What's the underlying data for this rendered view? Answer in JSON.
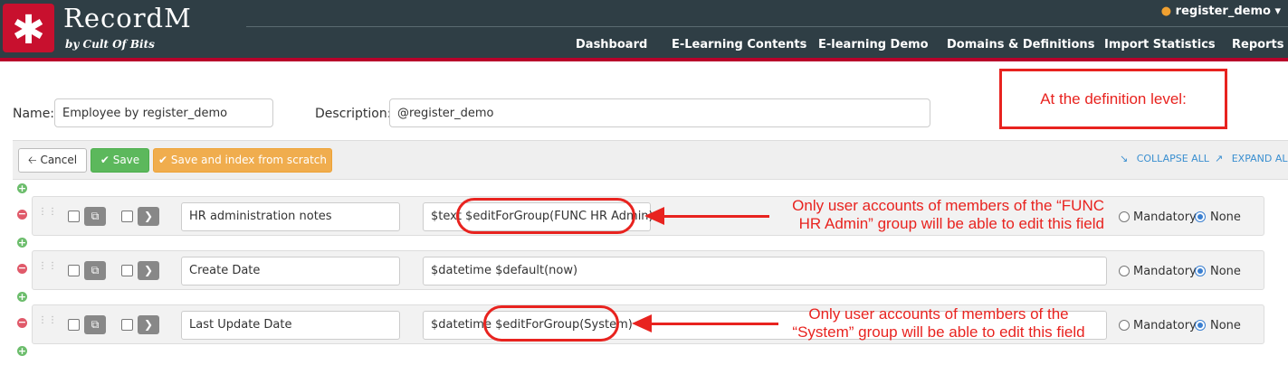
{
  "header": {
    "logo_glyph": "✱",
    "brand": "RecordM",
    "brand_sub": "by Cult Of Bits",
    "user": "register_demo",
    "nav": [
      "Dashboard",
      "E-Learning Contents",
      "E-learning Demo",
      "Domains & Definitions",
      "Import Statistics",
      "Reports"
    ]
  },
  "form": {
    "name_label": "Name:",
    "name_value": "Employee by register_demo",
    "description_label": "Description:",
    "description_value": "@register_demo"
  },
  "toolbar": {
    "cancel_label": "Cancel",
    "save_label": "Save",
    "index_label": "Save and index from scratch",
    "collapse_label": "COLLAPSE ALL",
    "expand_label": "EXPAND ALL"
  },
  "fields": [
    {
      "name": "HR administration notes",
      "definition": "$text $editForGroup(FUNC HR Admin)",
      "mandatory_label": "Mandatory",
      "none_label": "None"
    },
    {
      "name": "Create Date",
      "definition": "$datetime $default(now)",
      "mandatory_label": "Mandatory",
      "none_label": "None"
    },
    {
      "name": "Last Update Date",
      "definition": "$datetime $editForGroup(System)",
      "mandatory_label": "Mandatory",
      "none_label": "None"
    }
  ],
  "annotations": {
    "definition_level": "At the definition level:",
    "note1_line1": "Only user accounts of members of the “FUNC",
    "note1_line2": "HR Admin” group will be able to edit this field",
    "note2_line1": "Only user accounts of members of the",
    "note2_line2": "“System” group will be able to edit this field"
  },
  "colors": {
    "header_bg": "#2f3e45",
    "accent_red": "#c8102e",
    "annotation_red": "#e8231f",
    "save_green": "#5cb85c",
    "index_orange": "#f0ad4e",
    "link_blue": "#3a8fd0"
  },
  "icons": [
    "asterisk-logo-icon",
    "person-icon",
    "caret-down-icon",
    "arrow-left-icon",
    "check-icon",
    "compress-icon",
    "expand-icon",
    "drag-handle-icon",
    "copy-icon",
    "chevron-right-icon",
    "plus-circle-icon",
    "minus-circle-icon"
  ]
}
